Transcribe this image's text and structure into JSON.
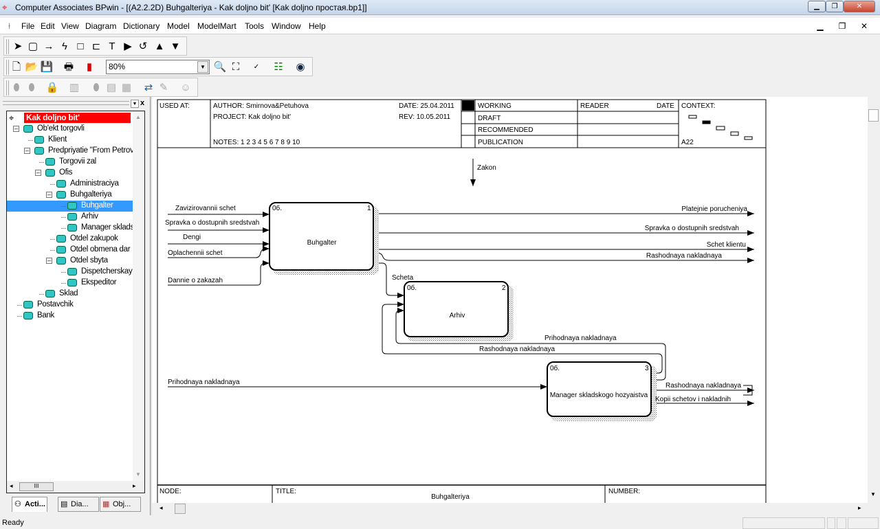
{
  "window": {
    "title": "Computer Associates BPwin - [(A2.2.2D) Buhgalteriya - Kak doljno bit'  [Kak doljno простая.bp1]]"
  },
  "menu": [
    "File",
    "Edit",
    "View",
    "Diagram",
    "Dictionary",
    "Model",
    "ModelMart",
    "Tools",
    "Window",
    "Help"
  ],
  "toolbar": {
    "zoom_value": "80%"
  },
  "tree": {
    "items": [
      {
        "level": 0,
        "label": "Kak doljno bit'",
        "root": true
      },
      {
        "level": 1,
        "label": "Ob'ekt torgovli",
        "expanded": true
      },
      {
        "level": 2,
        "label": "Klient"
      },
      {
        "level": 2,
        "label": "Predpriyatie  \"From Petrov",
        "expanded": true
      },
      {
        "level": 3,
        "label": "Torgovii zal"
      },
      {
        "level": 3,
        "label": "Ofis",
        "expanded": true
      },
      {
        "level": 4,
        "label": "Administraciya"
      },
      {
        "level": 4,
        "label": "Buhgalteriya",
        "expanded": true
      },
      {
        "level": 5,
        "label": "Buhgalter",
        "selected": true
      },
      {
        "level": 5,
        "label": "Arhiv"
      },
      {
        "level": 5,
        "label": "Manager sklads"
      },
      {
        "level": 4,
        "label": "Otdel zakupok"
      },
      {
        "level": 4,
        "label": "Otdel obmena  dar"
      },
      {
        "level": 4,
        "label": "Otdel sbyta",
        "expanded": true
      },
      {
        "level": 5,
        "label": "Dispetcherskay"
      },
      {
        "level": 5,
        "label": "Ekspeditor"
      },
      {
        "level": 3,
        "label": "Sklad"
      },
      {
        "level": 1,
        "label": "Postavchik"
      },
      {
        "level": 1,
        "label": "Bank"
      }
    ],
    "tabs": [
      "Acti...",
      "Dia...",
      "Obj..."
    ]
  },
  "header": {
    "used_at": "USED AT:",
    "author": "AUTHOR:  Smirnova&Petuhova",
    "project": "PROJECT:  Kak doljno bit'",
    "notes": "NOTES:  1  2  3  4  5  6  7  8  9  10",
    "date": "DATE:  25.04.2011",
    "rev": "REV:    10.05.2011",
    "working": "WORKING",
    "draft": "DRAFT",
    "recommended": "RECOMMENDED",
    "publication": "PUBLICATION",
    "reader": "READER",
    "reader_date": "DATE",
    "context": "CONTEXT:",
    "context_node": "A22"
  },
  "footer": {
    "node": "NODE:",
    "title_label": "TITLE:",
    "title": "Buhgalteriya",
    "number": "NUMBER:"
  },
  "diagram": {
    "boxes": [
      {
        "name": "Buhgalter",
        "num": "1",
        "tag": "0б."
      },
      {
        "name": "Arhiv",
        "num": "2",
        "tag": "0б."
      },
      {
        "name": "Manager skladskogo hozyaistva",
        "num": "3",
        "tag": "0б."
      }
    ],
    "arrows": {
      "zakon": "Zakon",
      "zavizirovannii": "Zavizirovannii schet",
      "spravka_in": "Spravka o dostupnih sredstvah",
      "dengi": "Dengi",
      "oplachennii": "Oplachennii schet",
      "dannie": "Dannie o zakazah",
      "platejnie": "Platejnie porucheniya",
      "spravka_out": "Spravka o dostupnih sredstvah",
      "schet_klientu": "Schet klientu",
      "rashodnaya1": "Rashodnaya nakladnaya",
      "scheta": "Scheta",
      "prihodnaya_loop": "Prihodnaya nakladnaya",
      "rashodnaya_loop": "Rashodnaya nakladnaya",
      "prihodnaya_in": "Prihodnaya nakladnaya",
      "rashodnaya_out": "Rashodnaya nakladnaya",
      "kopii": "Kopii schetov i nakladnih"
    }
  },
  "status": {
    "text": "Ready"
  }
}
